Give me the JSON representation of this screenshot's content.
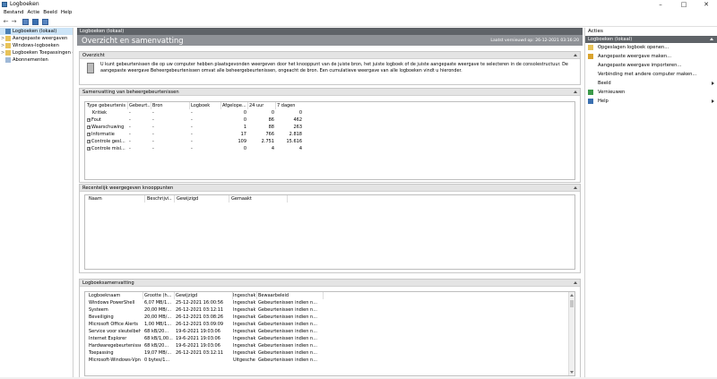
{
  "window": {
    "title": "Logboeken"
  },
  "menu": [
    "Bestand",
    "Actie",
    "Beeld",
    "Help"
  ],
  "tree": [
    {
      "label": "Logboeken (lokaal)",
      "selected": true,
      "exp": ""
    },
    {
      "label": "Aangepaste weergaven",
      "exp": ">"
    },
    {
      "label": "Windows-logboeken",
      "exp": ">"
    },
    {
      "label": "Logboeken Toepassingen en services",
      "exp": ">"
    },
    {
      "label": "Abonnementen",
      "exp": ""
    }
  ],
  "center": {
    "header": "Logboeken (lokaal)",
    "banner_title": "Overzicht en samenvatting",
    "last_refreshed": "Laatst vernieuwd op: 26-12-2021 03:16:20",
    "overview": {
      "title": "Overzicht",
      "text": "U kunt gebeurtenissen die op uw computer hebben plaatsgevonden weergeven door het knooppunt van de juiste bron, het juiste logboek of de juiste aangepaste weergave te selecteren in de consolestructuur. De aangepaste weergave Beheergebeurtenissen omvat alle beheergebeurtenissen, ongeacht de bron. Een cumulatieve weergave van alle logboeken vindt u hieronder."
    },
    "admin_summary": {
      "title": "Samenvatting van beheergebeurtenissen",
      "columns": [
        "Type gebeurtenis",
        "Gebeurt...",
        "Bron",
        "Logboek",
        "Afgelope...",
        "24 uur",
        "7 dagen"
      ],
      "rows": [
        {
          "type": "Kritiek",
          "expand": false,
          "id": "-",
          "source": "-",
          "log": "-",
          "hour": "0",
          "day": "0",
          "week": "0"
        },
        {
          "type": "Fout",
          "expand": true,
          "id": "-",
          "source": "-",
          "log": "-",
          "hour": "0",
          "day": "86",
          "week": "462"
        },
        {
          "type": "Waarschuwing",
          "expand": true,
          "id": "-",
          "source": "-",
          "log": "-",
          "hour": "1",
          "day": "88",
          "week": "263"
        },
        {
          "type": "Informatie",
          "expand": true,
          "id": "-",
          "source": "-",
          "log": "-",
          "hour": "17",
          "day": "766",
          "week": "2.818"
        },
        {
          "type": "Controle gesl...",
          "expand": true,
          "id": "-",
          "source": "-",
          "log": "-",
          "hour": "109",
          "day": "2.751",
          "week": "15.616"
        },
        {
          "type": "Controle misl...",
          "expand": true,
          "id": "-",
          "source": "-",
          "log": "-",
          "hour": "0",
          "day": "4",
          "week": "4"
        }
      ]
    },
    "recent_nodes": {
      "title": "Recentelijk weergegeven knooppunten",
      "columns": [
        "Naam",
        "Beschrijvi...",
        "Gewijzigd",
        "Gemaakt"
      ]
    },
    "log_summary": {
      "title": "Logboeksamenvatting",
      "columns": [
        "Logboeknaam",
        "Grootte (h...",
        "Gewijzigd",
        "Ingeschak...",
        "Bewaarbeleid"
      ],
      "rows": [
        [
          "Windows PowerShell",
          "6,07 MB/1...",
          "25-12-2021 16:00:56",
          "Ingeschak...",
          "Gebeurtenissen indien n..."
        ],
        [
          "Systeem",
          "20,00 MB/...",
          "26-12-2021 03:12:11",
          "Ingeschak...",
          "Gebeurtenissen indien n..."
        ],
        [
          "Beveiliging",
          "20,00 MB/...",
          "26-12-2021 03:08:26",
          "Ingeschak...",
          "Gebeurtenissen indien n..."
        ],
        [
          "Microsoft Office Alerts",
          "1,00 MB/1...",
          "26-12-2021 03:09:09",
          "Ingeschak...",
          "Gebeurtenissen indien n..."
        ],
        [
          "Service voor sleutelbeheer",
          "68 kB/20...",
          "19-6-2021 19:03:06",
          "Ingeschak...",
          "Gebeurtenissen indien n..."
        ],
        [
          "Internet Explorer",
          "68 kB/1,00...",
          "19-6-2021 19:03:06",
          "Ingeschak...",
          "Gebeurtenissen indien n..."
        ],
        [
          "Hardwaregebeurtenissen",
          "68 kB/20...",
          "19-6-2021 19:03:06",
          "Ingeschak...",
          "Gebeurtenissen indien n..."
        ],
        [
          "Toepassing",
          "19,07 MB/...",
          "26-12-2021 03:12:11",
          "Ingeschak...",
          "Gebeurtenissen indien n..."
        ],
        [
          "Microsoft-Windows-Vpn...",
          "0 bytes/1...",
          "",
          "Uitgesche...",
          "Gebeurtenissen indien n..."
        ]
      ]
    }
  },
  "actions": {
    "title": "Acties",
    "subheader": "Logboeken (lokaal)",
    "items": [
      {
        "label": "Opgeslagen logboek openen...",
        "icon": "folder-open-icon",
        "arrow": false
      },
      {
        "label": "Aangepaste weergave maken...",
        "icon": "filter-icon",
        "arrow": false
      },
      {
        "label": "Aangepaste weergave importeren...",
        "icon": "",
        "arrow": false
      },
      {
        "label": "Verbinding met andere computer maken...",
        "icon": "",
        "arrow": false
      },
      {
        "label": "Beeld",
        "icon": "",
        "arrow": true
      },
      {
        "label": "Vernieuwen",
        "icon": "refresh-icon",
        "arrow": false
      },
      {
        "label": "Help",
        "icon": "help-icon",
        "arrow": true
      }
    ]
  }
}
